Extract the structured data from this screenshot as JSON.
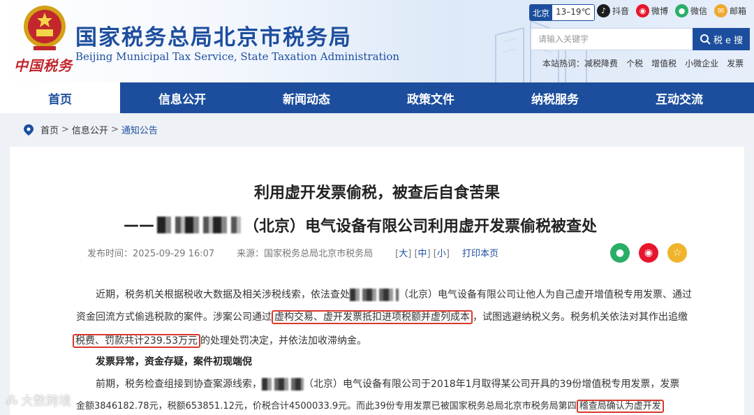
{
  "header": {
    "emblem_icon": "national-emblem-icon",
    "logo_text": "中国税务",
    "title": "国家税务总局北京市税务局",
    "subtitle": "Beijing Municipal Tax Service, State Taxation Administration"
  },
  "weather": {
    "city": "北京",
    "temp": "13–19℃"
  },
  "social": [
    {
      "label": "抖音",
      "icon": "douyin-icon",
      "color": "#1d1d1d"
    },
    {
      "label": "微博",
      "icon": "weibo-icon",
      "color": "#e6162d"
    },
    {
      "label": "微信",
      "icon": "wechat-icon",
      "color": "#2aae67"
    },
    {
      "label": "邮箱",
      "icon": "mail-icon",
      "color": "#f0a830"
    }
  ],
  "search": {
    "placeholder": "请输入关键字",
    "button_label": "税 e 搜"
  },
  "hot": {
    "label": "本站热词：",
    "items": [
      "减税降费",
      "个税",
      "增值税",
      "小微企业",
      "发票"
    ]
  },
  "nav": {
    "items": [
      "首页",
      "信息公开",
      "新闻动态",
      "政策文件",
      "纳税服务",
      "互动交流"
    ]
  },
  "breadcrumb": {
    "items": [
      "首页",
      "信息公开",
      "通知公告"
    ],
    "separator": ">"
  },
  "article": {
    "title": "利用虚开发票偷税，被查后自食苦果",
    "subtitle_prefix": "——",
    "subtitle_suffix": "（北京）电气设备有限公司利用虚开发票偷税被查处",
    "publish_time": "发布时间：2025-09-29 16:07",
    "source": "来源：国家税务总局北京市税务局",
    "font_size": {
      "large": "大",
      "medium": "中",
      "small": "小"
    },
    "print": "打印本页",
    "p1_a": "近期，税务机关根据税收大数据及相关涉税线索，依法查处",
    "p1_b": "（北京）电气设备有限公司让他人为自己虚开增值税专用发票、通过",
    "p2_a": "资金回流方式偷逃税款的案件。涉案公司通过",
    "p2_hl": "虚构交易、虚开发票抵扣进项税额并虚列成本",
    "p2_b": "，试图逃避纳税义务。税务机关依法对其作出追缴",
    "p3_hl": "税费、罚款共计239.53万元",
    "p3_b": "的处理处罚决定，并依法加收滞纳金。",
    "heading": "发票异常，资金存疑，案件初现端倪",
    "p4_a": "前期，税务检查组接到协查案源线索，",
    "p4_b": "（北京）电气设备有限公司于2018年1月取得某公司开具的39份增值税专用发票，发票",
    "p5_a": "金额3846182.78元，税额653851.12元，价税合计4500033.9元。而此39份专用发票已被国家税务总局北京市税务局第四",
    "p5_hl": "稽查局确认为虚开发"
  },
  "watermark": "大数跨境",
  "colors": {
    "brand": "#1d4e9e",
    "highlight": "#d9382c"
  }
}
